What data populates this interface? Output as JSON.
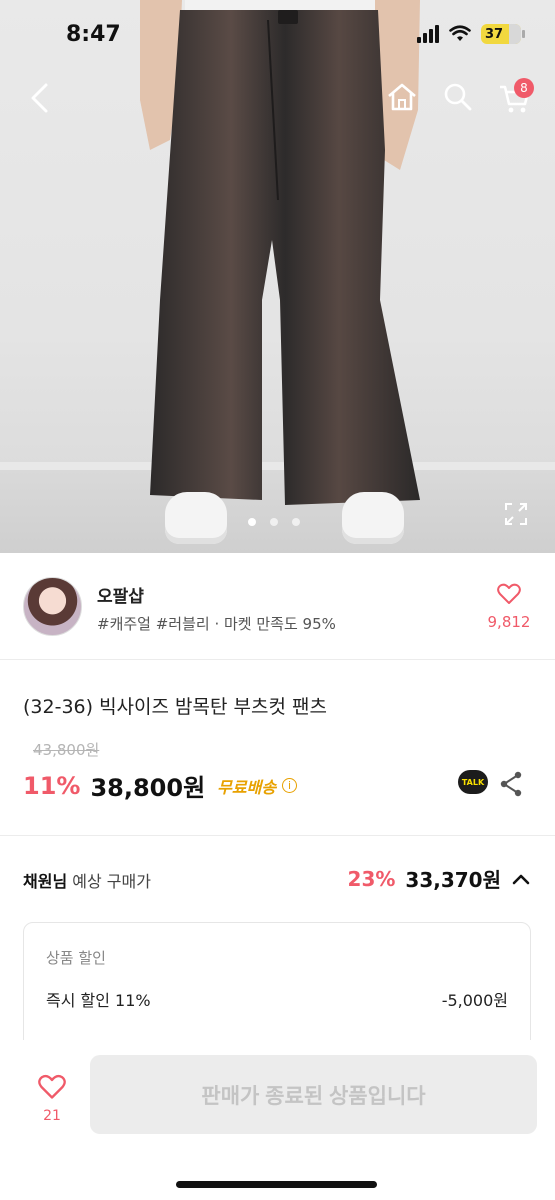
{
  "status_bar": {
    "time": "8:47",
    "battery": "37"
  },
  "nav": {
    "cart_count": "8"
  },
  "carousel": {
    "pages": 3,
    "current": 1
  },
  "seller": {
    "name": "오팔샵",
    "tags": "#캐주얼 #러블리 · 마켓 만족도 95%",
    "like_count": "9,812"
  },
  "product": {
    "title": "(32-36) 빅사이즈 밤목탄 부츠컷 팬츠",
    "original_price": "43,800원",
    "discount": "11%",
    "price": "38,800원",
    "free_shipping": "무료배송",
    "talk_label": "TALK"
  },
  "expected_price": {
    "user": "채원님",
    "label": "예상 구매가",
    "percent": "23%",
    "price": "33,370원"
  },
  "discount_detail": {
    "heading": "상품 할인",
    "item_label": "즉시 할인 11%",
    "item_value": "-5,000원"
  },
  "bottom": {
    "wish_count": "21",
    "sold_out_label": "판매가 종료된 상품입니다"
  },
  "colors": {
    "accent": "#f05a69",
    "free_shipping": "#e8a100"
  }
}
